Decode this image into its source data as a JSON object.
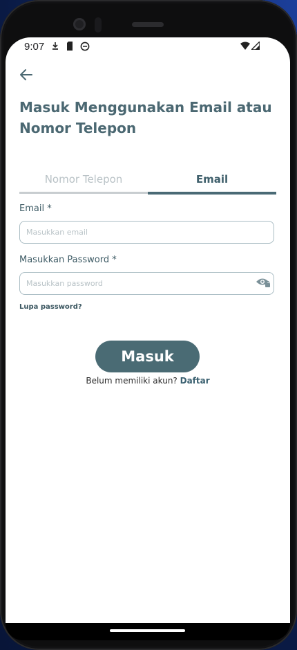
{
  "status_bar": {
    "time": "9:07",
    "left_icons": [
      "download-icon",
      "sim-card-icon",
      "circle-app-icon"
    ],
    "right_icons": [
      "wifi-icon",
      "signal-icon"
    ]
  },
  "header": {
    "back_icon": "arrow-left-icon",
    "title": "Masuk Menggunakan Email atau Nomor Telepon"
  },
  "tabs": [
    {
      "label": "Nomor Telepon",
      "active": false
    },
    {
      "label": "Email",
      "active": true
    }
  ],
  "form": {
    "email_label": "Email *",
    "email_placeholder": "Masukkan email",
    "email_value": "",
    "password_label": "Masukkan Password *",
    "password_placeholder": "Masukkan password",
    "password_value": "",
    "password_toggle_icon": "eye-icon",
    "forgot_label": "Lupa password?",
    "submit_label": "Masuk",
    "signup_prompt": "Belum memiliki akun?",
    "signup_link": "Daftar"
  },
  "colors": {
    "primary": "#4A6B74",
    "title": "#4B6872",
    "tab_inactive": "#B9C2C6",
    "input_border": "#A9BCC3"
  }
}
